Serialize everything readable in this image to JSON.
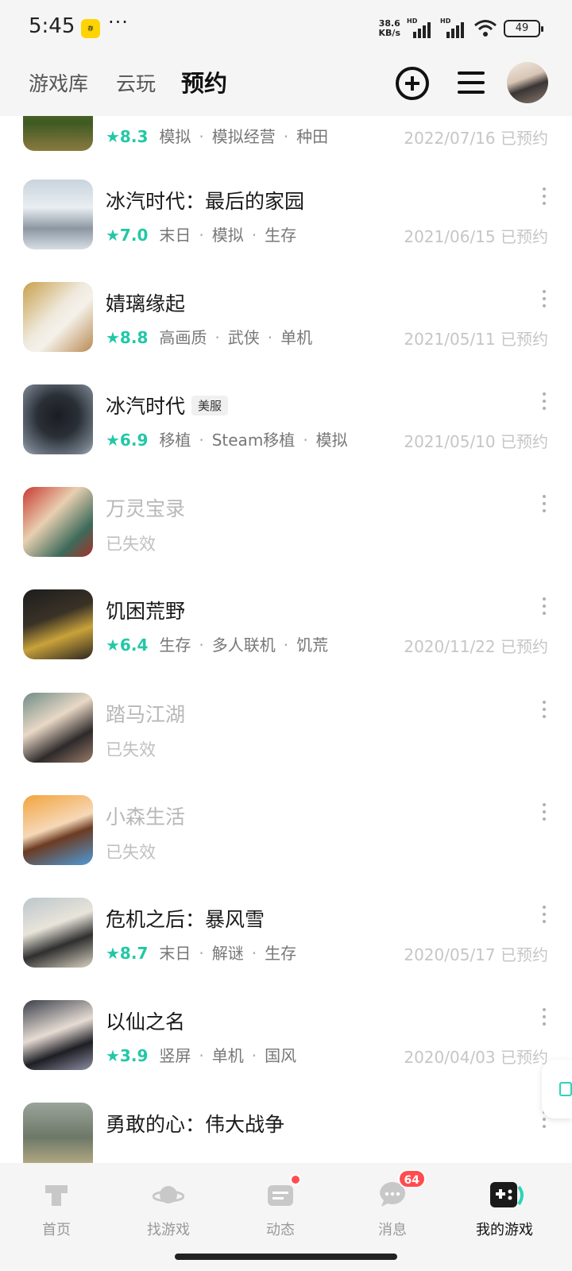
{
  "status_bar": {
    "time": "5:45",
    "app_icon_text": "存",
    "dots": "···",
    "speed_top": "38.6",
    "speed_bottom": "KB/s",
    "hd1": "HD",
    "hd2": "HD",
    "battery": "49"
  },
  "header": {
    "tabs": [
      {
        "label": "游戏库"
      },
      {
        "label": "云玩"
      },
      {
        "label": "预约"
      }
    ],
    "active_tab": "预约",
    "accent_color": "#2bd4b8"
  },
  "games": [
    {
      "title": "",
      "rating": "★8.3",
      "tags": [
        "模拟",
        "模拟经营",
        "种田"
      ],
      "date": "2022/07/16 已预约"
    },
    {
      "title": "冰汽时代：最后的家园",
      "rating": "★7.0",
      "tags": [
        "末日",
        "模拟",
        "生存"
      ],
      "date": "2021/06/15 已预约"
    },
    {
      "title": "婧璃缘起",
      "rating": "★8.8",
      "tags": [
        "高画质",
        "武侠",
        "单机"
      ],
      "date": "2021/05/11 已预约"
    },
    {
      "title": "冰汽时代",
      "badge": "美服",
      "rating": "★6.9",
      "tags": [
        "移植",
        "Steam移植",
        "模拟"
      ],
      "date": "2021/05/10 已预约"
    },
    {
      "title": "万灵宝录",
      "expired": "已失效"
    },
    {
      "title": "饥困荒野",
      "rating": "★6.4",
      "tags": [
        "生存",
        "多人联机",
        "饥荒"
      ],
      "date": "2020/11/22 已预约"
    },
    {
      "title": "踏马江湖",
      "expired": "已失效"
    },
    {
      "title": "小森生活",
      "expired": "已失效"
    },
    {
      "title": "危机之后：暴风雪",
      "rating": "★8.7",
      "tags": [
        "末日",
        "解谜",
        "生存"
      ],
      "date": "2020/05/17 已预约"
    },
    {
      "title": "以仙之名",
      "rating": "★3.9",
      "tags": [
        "竖屏",
        "单机",
        "国风"
      ],
      "date": "2020/04/03 已预约"
    },
    {
      "title": "勇敢的心：伟大战争"
    }
  ],
  "bottom_nav": [
    {
      "label": "首页",
      "icon": "home-icon"
    },
    {
      "label": "找游戏",
      "icon": "planet-icon"
    },
    {
      "label": "动态",
      "icon": "feed-icon"
    },
    {
      "label": "消息",
      "icon": "message-icon",
      "count": "64"
    },
    {
      "label": "我的游戏",
      "icon": "gamepad-icon"
    }
  ]
}
